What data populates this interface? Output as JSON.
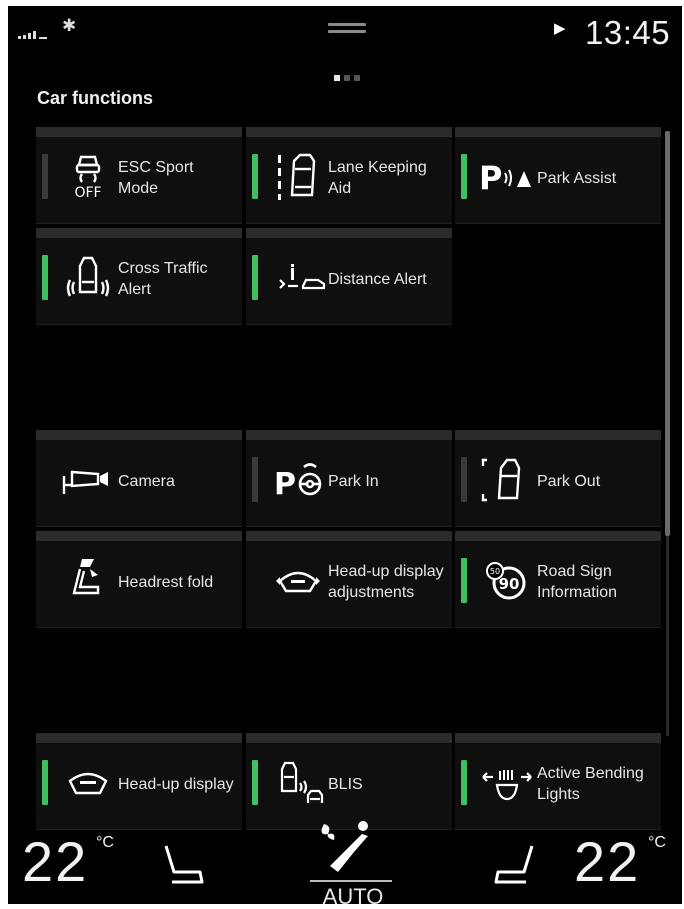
{
  "status": {
    "bluetooth_icon": "bluetooth-icon",
    "play_icon": "play-icon",
    "time": "13:45"
  },
  "page": {
    "pages": 3,
    "active": 1
  },
  "section_title": "Car functions",
  "tiles": [
    {
      "label": "ESC Sport Mode",
      "icon": "esc-off-icon",
      "indicator": "off"
    },
    {
      "label": "Lane Keeping Aid",
      "icon": "lane-keeping-icon",
      "indicator": "on"
    },
    {
      "label": "Park Assist",
      "icon": "park-assist-icon",
      "indicator": "on"
    },
    {
      "label": "Cross Traffic Alert",
      "icon": "cross-traffic-icon",
      "indicator": "on"
    },
    {
      "label": "Distance Alert",
      "icon": "distance-alert-icon",
      "indicator": "on"
    },
    {
      "label": "Camera",
      "icon": "camera-icon",
      "indicator": "none"
    },
    {
      "label": "Park In",
      "icon": "park-in-icon",
      "indicator": "off"
    },
    {
      "label": "Park Out",
      "icon": "park-out-icon",
      "indicator": "off"
    },
    {
      "label": "Headrest fold",
      "icon": "headrest-icon",
      "indicator": "none"
    },
    {
      "label": "Head-up display adjustments",
      "icon": "hud-adjust-icon",
      "indicator": "none"
    },
    {
      "label": "Road Sign Information",
      "icon": "road-sign-icon",
      "indicator": "on"
    },
    {
      "label": "Head-up display",
      "icon": "hud-icon",
      "indicator": "on"
    },
    {
      "label": "BLIS",
      "icon": "blis-icon",
      "indicator": "on"
    },
    {
      "label": "Active Bending Lights",
      "icon": "bending-lights-icon",
      "indicator": "on"
    }
  ],
  "climate": {
    "left_temp": "22",
    "right_temp": "22",
    "unit": "°C",
    "mode": "AUTO"
  },
  "colors": {
    "indicator_on": "#3fbf5f",
    "indicator_off": "#3a3a3a",
    "background": "#000000"
  }
}
